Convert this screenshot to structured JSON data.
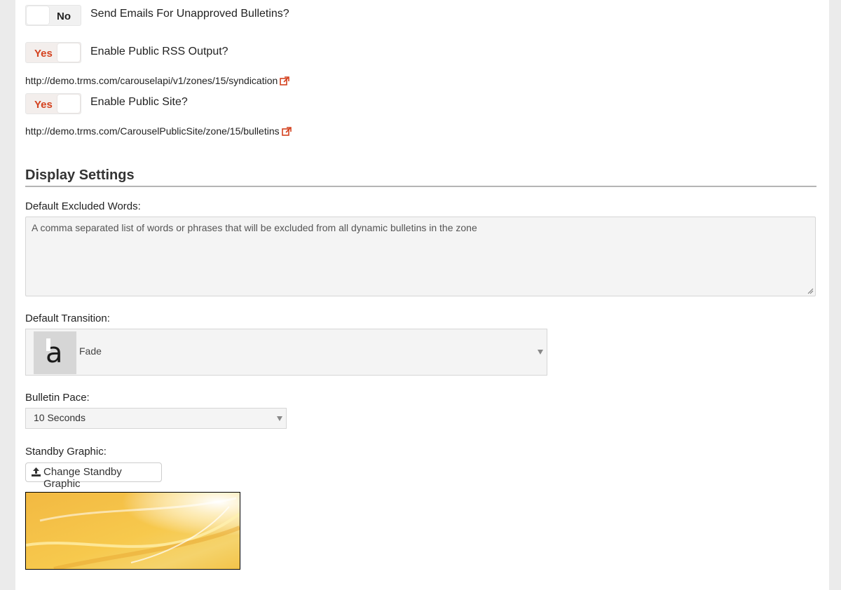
{
  "notifications": {
    "unapproved_emails": {
      "label": "Send Emails For Unapproved Bulletins?",
      "state": "No"
    },
    "public_rss": {
      "label": "Enable Public RSS Output?",
      "state": "Yes",
      "url": "http://demo.trms.com/carouselapi/v1/zones/15/syndication"
    },
    "public_site": {
      "label": "Enable Public Site?",
      "state": "Yes",
      "url": "http://demo.trms.com/CarouselPublicSite/zone/15/bulletins"
    }
  },
  "display_settings": {
    "title": "Display Settings",
    "excluded_words": {
      "label": "Default Excluded Words:",
      "value": "",
      "placeholder": "A comma separated list of words or phrases that will be excluded from all dynamic bulletins in the zone"
    },
    "transition": {
      "label": "Default Transition:",
      "selected": "Fade",
      "thumb_glyph": "a"
    },
    "pace": {
      "label": "Bulletin Pace:",
      "selected": "10 Seconds"
    },
    "standby": {
      "label": "Standby Graphic:",
      "button_label": "Change Standby Graphic"
    }
  },
  "icons": {
    "toggle": "toggle-switch",
    "external_link": "external-link-icon",
    "upload": "upload-icon",
    "caret": "caret-down-icon",
    "resize": "resize-grip-icon"
  },
  "colors": {
    "accent": "#d4411e",
    "toggle_off_bg": "#f1f1f1",
    "field_bg": "#f4f4f4",
    "rule": "#b5b5b5"
  }
}
